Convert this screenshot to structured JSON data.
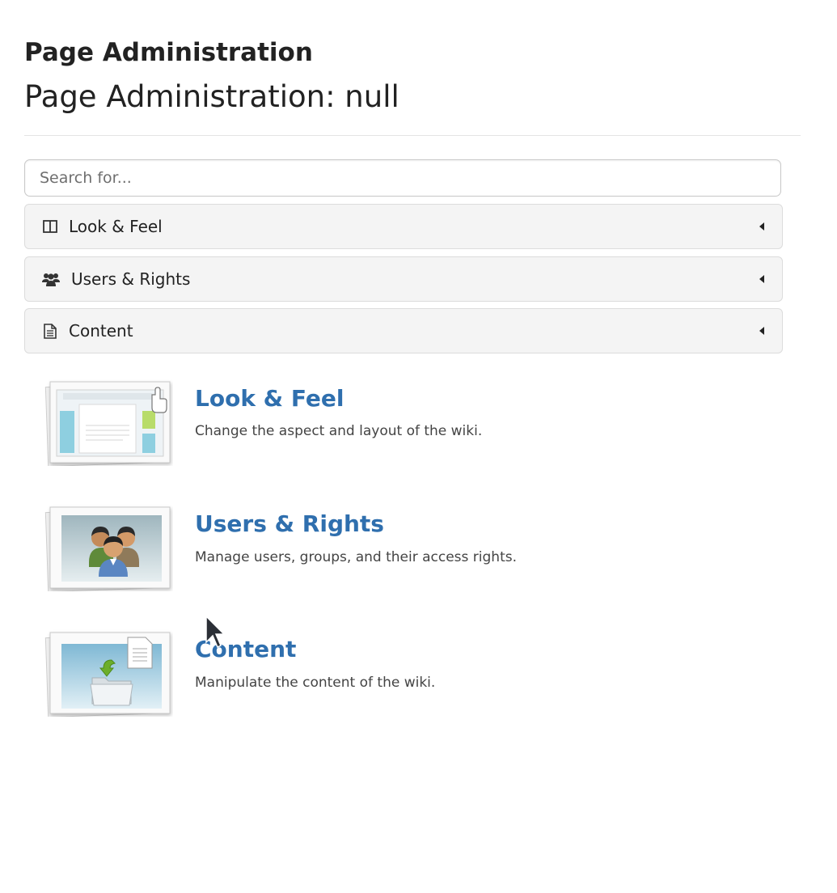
{
  "header": {
    "title": "Page Administration",
    "subtitle": "Page Administration: null"
  },
  "search": {
    "placeholder": "Search for...",
    "value": ""
  },
  "panels": [
    {
      "label": "Look & Feel",
      "icon": "columns-icon"
    },
    {
      "label": "Users & Rights",
      "icon": "users-icon"
    },
    {
      "label": "Content",
      "icon": "document-icon"
    }
  ],
  "categories": [
    {
      "title": "Look & Feel",
      "description": "Change the aspect and layout of the wiki.",
      "icon": "layout-thumbnail-icon"
    },
    {
      "title": "Users & Rights",
      "description": "Manage users, groups, and their access rights.",
      "icon": "users-thumbnail-icon"
    },
    {
      "title": "Content",
      "description": "Manipulate the content of the wiki.",
      "icon": "content-thumbnail-icon"
    }
  ],
  "colors": {
    "link": "#2f6fae",
    "panel_background": "#f4f4f4",
    "panel_border": "#dcdcdc"
  }
}
